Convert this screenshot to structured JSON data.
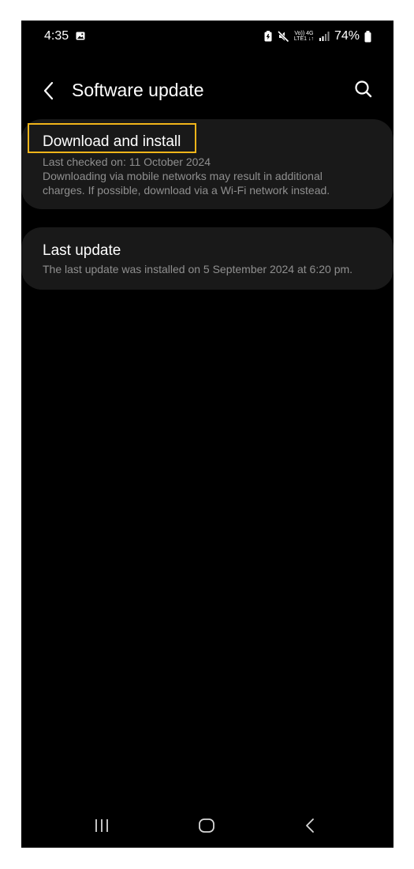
{
  "status_bar": {
    "time": "4:35",
    "battery": "74%",
    "network_top": "Vo)) 4G",
    "network_bottom": "LTE1 ↓↑",
    "icons": [
      "gallery-icon",
      "battery-saver-icon",
      "mute-icon",
      "volte-icon",
      "signal-icon",
      "battery-icon"
    ]
  },
  "header": {
    "title": "Software update",
    "back_icon": "chevron-left-icon",
    "search_icon": "search-icon"
  },
  "download_card": {
    "title": "Download and install",
    "last_checked": "Last checked on: 11 October 2024",
    "note_line1": "Downloading via mobile networks may result in additional",
    "note_line2": "charges. If possible, download via a Wi-Fi network instead.",
    "highlight_color": "#f2b51a"
  },
  "last_update_card": {
    "title": "Last update",
    "detail": "The last update was installed on 5 September 2024 at 6:20 pm."
  },
  "nav_bar": {
    "items": [
      "recents-icon",
      "home-icon",
      "back-icon"
    ]
  },
  "colors": {
    "background": "#000000",
    "card": "#191919",
    "text_primary": "#ffffff",
    "text_secondary": "#8f8f8f"
  }
}
